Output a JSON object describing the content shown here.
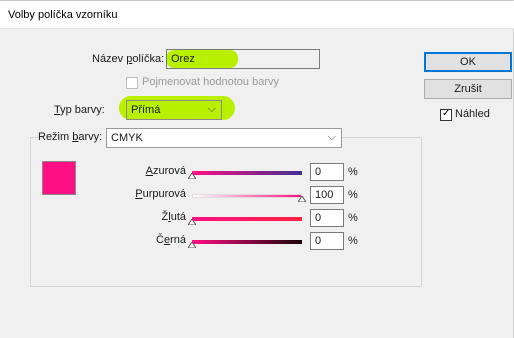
{
  "window": {
    "title": "Volby políčka vzorníku"
  },
  "name_field": {
    "label_prefix": "Název ",
    "label_u": "p",
    "label_rest": "olíčka:",
    "value": "Orez"
  },
  "name_with_value": {
    "label": "Pojmenovat hodnotou barvy",
    "checked": false
  },
  "color_type": {
    "label_u": "T",
    "label_rest": "yp barvy:",
    "value": "Přímá"
  },
  "color_mode": {
    "label_prefix": "Režim ",
    "label_u": "b",
    "label_rest": "arvy:",
    "value": "CMYK"
  },
  "buttons": {
    "ok": "OK",
    "cancel": "Zrušit"
  },
  "preview": {
    "label": "Náhled",
    "checked": true
  },
  "swatch_color": "#ff0f84",
  "highlight_color": "#b8f000",
  "channels": [
    {
      "label_u": "A",
      "label_rest": "zurová",
      "value": "0",
      "pct": "%",
      "thumb": 0.0
    },
    {
      "label_u": "P",
      "label_rest": "urpurová",
      "value": "100",
      "pct": "%",
      "thumb": 1.0
    },
    {
      "label_prefix": "Ž",
      "label_u": "l",
      "label_rest": "utá",
      "value": "0",
      "pct": "%",
      "thumb": 0.0
    },
    {
      "label_prefix": "Č",
      "label_u": "e",
      "label_rest": "rná",
      "value": "0",
      "pct": "%",
      "thumb": 0.0
    }
  ]
}
